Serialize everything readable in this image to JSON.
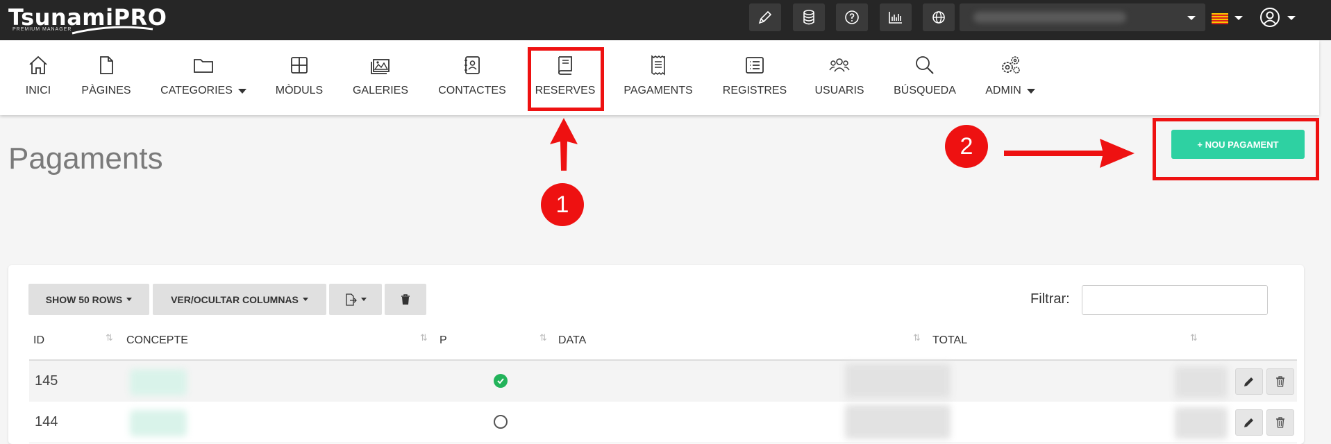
{
  "app": {
    "logo_text": "TsunamiPRO",
    "logo_sub": "PREMIUM MANAGER"
  },
  "topbar": {
    "icons": [
      "pencil-icon",
      "database-icon",
      "help-icon",
      "stats-icon",
      "globe-icon"
    ],
    "site_selector_value": "",
    "language_flag": "catalan-flag-icon",
    "user_icon": "user-circle-icon"
  },
  "nav": {
    "items": [
      {
        "label": "INICI",
        "icon": "home-icon"
      },
      {
        "label": "PÀGINES",
        "icon": "file-icon"
      },
      {
        "label": "CATEGORIES",
        "icon": "folder-icon"
      },
      {
        "label": "MÒDULS",
        "icon": "grid-icon"
      },
      {
        "label": "GALERIES",
        "icon": "images-icon"
      },
      {
        "label": "CONTACTES",
        "icon": "contact-book-icon"
      },
      {
        "label": "RESERVES",
        "icon": "book-icon"
      },
      {
        "label": "PAGAMENTS",
        "icon": "receipt-icon"
      },
      {
        "label": "REGISTRES",
        "icon": "list-icon"
      },
      {
        "label": "USUARIS",
        "icon": "users-icon"
      },
      {
        "label": "BÚSQUEDA",
        "icon": "search-icon"
      },
      {
        "label": "ADMIN",
        "icon": "gears-icon"
      }
    ]
  },
  "page": {
    "title": "Pagaments",
    "new_button": "+ NOU PAGAMENT"
  },
  "annotations": {
    "step1": "1",
    "step2": "2",
    "color": "#ee1111"
  },
  "toolbar": {
    "show_rows": "SHOW 50 ROWS",
    "columns": "VER/OCULTAR COLUMNAS",
    "export_icon": "export-icon",
    "delete_icon": "trash-icon",
    "filter_label": "Filtrar:",
    "filter_value": ""
  },
  "table": {
    "columns": [
      "ID",
      "CONCEPTE",
      "P",
      "DATA",
      "TOTAL"
    ],
    "rows": [
      {
        "id": "145",
        "paid": true
      },
      {
        "id": "144",
        "paid": false
      }
    ]
  },
  "colors": {
    "topbar": "#262626",
    "accent": "#2ed1a2",
    "highlight": "#ee1111"
  }
}
